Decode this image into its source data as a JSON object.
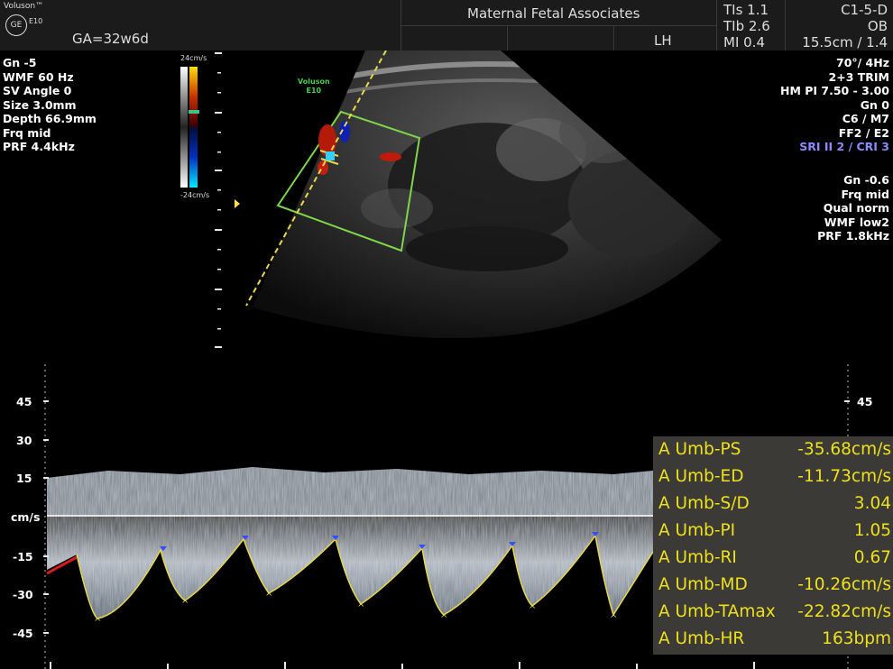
{
  "header": {
    "brand": "Voluson™",
    "brand_sub": "E10",
    "logo": "GE",
    "ga": "GA=32w6d",
    "clinic": "Maternal Fetal Associates",
    "lh": "LH",
    "tis": "TIs  1.1",
    "tib": "TIb  2.6",
    "mi": "MI  0.4",
    "probe": "C1-5-D",
    "app": "OB",
    "depth_zoom": "15.5cm / 1.4"
  },
  "left_info": [
    "Gn  -5",
    "WMF 60 Hz",
    "SV Angle  0",
    "Size  3.0mm",
    "Depth 66.9mm",
    "Frq mid",
    "PRF  4.4kHz"
  ],
  "right_info_top": [
    "70°/  4Hz",
    "2+3 TRIM",
    "HM PI 7.50 - 3.00",
    "Gn   0",
    "C6 / M7",
    "FF2 / E2"
  ],
  "right_info_sri": "SRI II 2 / CRI 3",
  "right_info_bottom": [
    "Gn -0.6",
    "Frq mid",
    "Qual norm",
    "WMF low2",
    "PRF  1.8kHz"
  ],
  "color_scale": {
    "top": "24cm/s",
    "bottom": "-24cm/s"
  },
  "voluson_tag": [
    "Voluson",
    "E10"
  ],
  "spectrum": {
    "unit": "cm/s",
    "ticks_left": [
      "45",
      "30",
      "15",
      "-15",
      "-30",
      "-45"
    ],
    "tick_right": "45"
  },
  "measurements": [
    {
      "label": "A Umb-PS",
      "value": "-35.68cm/s"
    },
    {
      "label": "A Umb-ED",
      "value": "-11.73cm/s"
    },
    {
      "label": "A Umb-S/D",
      "value": "3.04"
    },
    {
      "label": "A Umb-PI",
      "value": "1.05"
    },
    {
      "label": "A Umb-RI",
      "value": "0.67"
    },
    {
      "label": "A Umb-MD",
      "value": "-10.26cm/s"
    },
    {
      "label": "A Umb-TAmax",
      "value": "-22.82cm/s"
    },
    {
      "label": "A Umb-HR",
      "value": "163bpm"
    }
  ],
  "colors": {
    "measurement_text": "#ede01c",
    "trace": "#e8d84a",
    "roi_box": "#7fd64a",
    "cursor_line": "#e8d84a"
  }
}
